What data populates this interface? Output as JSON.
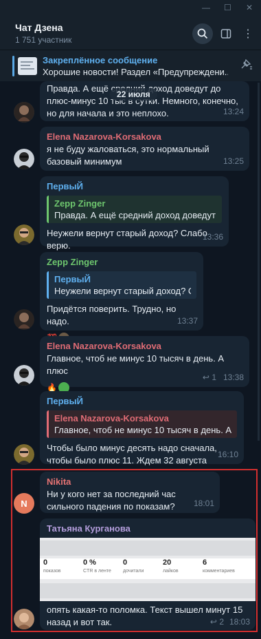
{
  "window": {
    "controls": [
      "—",
      "☐",
      "✕"
    ]
  },
  "header": {
    "title": "Чат Дзена",
    "subtitle": "1 751 участник"
  },
  "pinned": {
    "title": "Закреплённое сообщение",
    "text": "Хорошие новости! Раздел «Предупреждени..."
  },
  "date_separator": "22 июля",
  "messages": [
    {
      "text": "Правда. А ещё средний доход доведут до плюс-минус 10 тыс в сутки. Немного, конечно, но для начала и это неплохо.",
      "time": "13:24"
    },
    {
      "author": "Elena Nazarova-Korsakova",
      "text": "я не буду жаловаться, это нормальный базовый минимум",
      "time": "13:25"
    },
    {
      "author": "ПервыЙ",
      "quote_author": "Zepp Zinger",
      "quote_text": "Правда. А ещё средний доход доведут д...",
      "text": "Неужели вернут старый доход? Слабо верю.",
      "time": "13:36"
    },
    {
      "author": "Zepp Zinger",
      "quote_author": "ПервыЙ",
      "quote_text": "Неужели вернут старый доход? С...",
      "text": "Придётся поверить. Трудно, но надо.",
      "time": "13:37",
      "reaction": "💯"
    },
    {
      "author": "Elena Nazarova-Korsakova",
      "text": "Главное, чтоб не минус 10 тысяч в день. А плюс",
      "time": "13:38",
      "replies": "1",
      "reaction": "🔥"
    },
    {
      "author": "ПервыЙ",
      "quote_author": "Elena Nazarova-Korsakova",
      "quote_text": "Главное, чтоб не минус 10 тысяч в день. А плюс",
      "text": "Чтобы было минус десять надо сначала, чтобы было плюс 11. Ждем 32 августа",
      "time": "16:10"
    },
    {
      "author": "Nikita",
      "avatar_letter": "N",
      "text": "Ни у кого нет за последний час сильного падения по показам?",
      "time": "18:01"
    },
    {
      "author": "Татьяна Курганова",
      "text": "опять какая-то поломка. Текст вышел минут 15 назад и вот так.",
      "time": "18:03",
      "replies": "2"
    }
  ],
  "stats": [
    {
      "value": "0",
      "label": "показов"
    },
    {
      "value": "0 %",
      "label": "CTR в ленте"
    },
    {
      "value": "0",
      "label": "дочитали"
    },
    {
      "value": "20",
      "label": "лайков"
    },
    {
      "value": "6",
      "label": "комментариев"
    }
  ],
  "colors": {
    "elena": "#e06c75",
    "pervyi": "#5fb0ef",
    "zepp": "#6ec66e",
    "nikita": "#e57373",
    "tatyana": "#b39ddb"
  }
}
